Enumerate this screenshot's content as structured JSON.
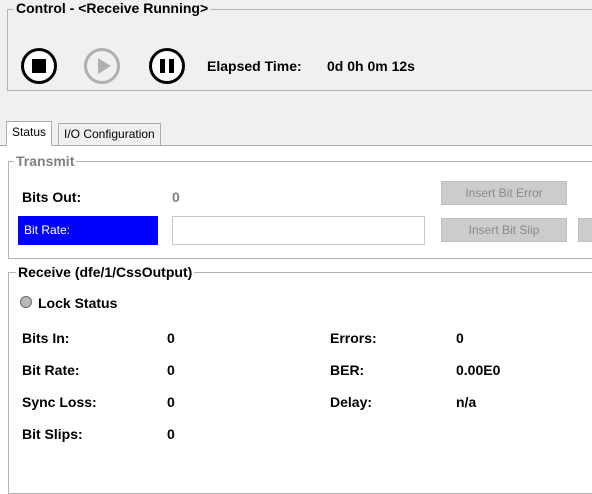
{
  "control": {
    "title": "Control - <Receive Running>",
    "elapsed_label": "Elapsed Time:",
    "elapsed_value": "0d 0h 0m 12s",
    "buttons": {
      "stop": "stop-icon",
      "play": "play-icon",
      "pause": "pause-icon"
    }
  },
  "tabs": [
    {
      "label": "Status",
      "active": true
    },
    {
      "label": "I/O Configuration",
      "active": false
    }
  ],
  "transmit": {
    "title": "Transmit",
    "bits_out_label": "Bits Out:",
    "bits_out_value": "0",
    "bit_rate_label": "Bit Rate:",
    "bit_rate_value": "",
    "insert_bit_error": "Insert Bit Error",
    "insert_bit_slip": "Insert Bit Slip"
  },
  "receive": {
    "title": "Receive  (dfe/1/CssOutput)",
    "lock_status_label": "Lock Status",
    "bits_in_label": "Bits In:",
    "bits_in_value": "0",
    "bit_rate_label": "Bit Rate:",
    "bit_rate_value": "0",
    "sync_loss_label": "Sync Loss:",
    "sync_loss_value": "0",
    "bit_slips_label": "Bit Slips:",
    "bit_slips_value": "0",
    "errors_label": "Errors:",
    "errors_value": "0",
    "ber_label": "BER:",
    "ber_value": "0.00E0",
    "delay_label": "Delay:",
    "delay_value": "n/a"
  },
  "colors": {
    "panel_bg": "#f0f0f0",
    "highlight": "#0000ff",
    "disabled_button": "#cccccc",
    "lock_indicator": "#b9b9b9"
  }
}
